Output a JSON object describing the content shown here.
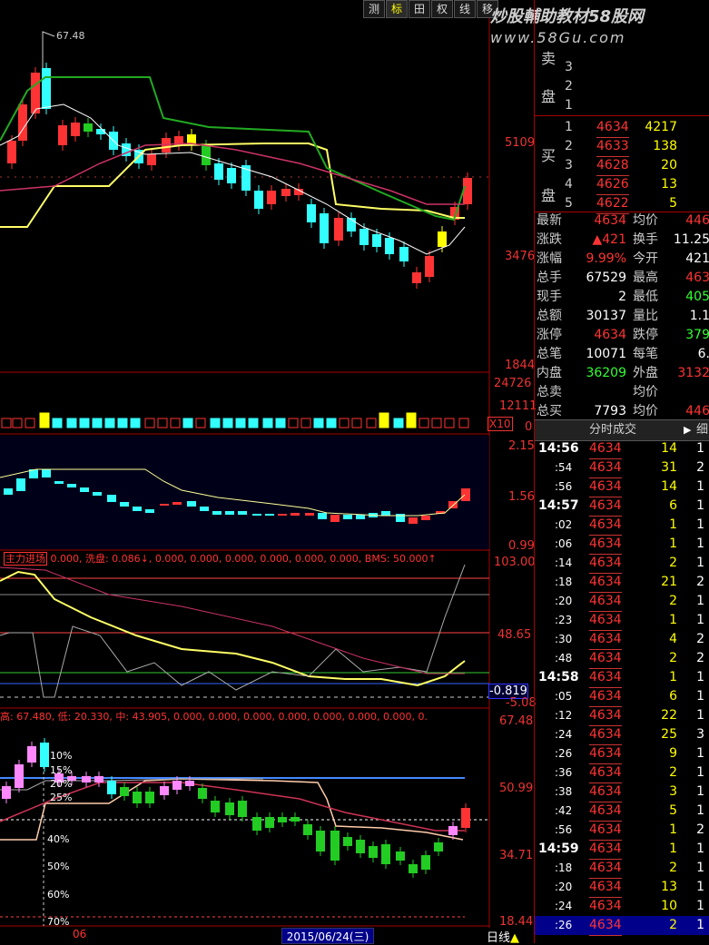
{
  "toolbar": [
    "测",
    "标",
    "田",
    "权",
    "线",
    "移"
  ],
  "toolbar_active": 1,
  "watermark": {
    "line1": "炒股輔助教材58股网",
    "line2": "www.58Gu.com"
  },
  "price_axis": [
    "5109",
    "3476",
    "1844"
  ],
  "peak_label": "67.48",
  "vol_axis": [
    "24726",
    "12111",
    "0"
  ],
  "vol_unit": "X10",
  "mid_axis": [
    "2.15",
    "1.56",
    "0.99"
  ],
  "ind1": {
    "title": "主力进场",
    "values": "0.000, 洗盘: 0.086↓, 0.000, 0.000, 0.000, 0.000, 0.000, 0.000, BMS: 50.000↑",
    "axis": [
      "103.00",
      "48.65",
      "-0.819",
      "-5.08"
    ]
  },
  "ind2": {
    "label": "高: 67.480, 低: 20.330, 中: 43.905, 0.000, 0.000, 0.000, 0.000, 0.000, 0.000, 0.000, 0.",
    "axis": [
      "67.48",
      "50.99",
      "34.71",
      "18.44"
    ],
    "pcts": [
      "10%",
      "15%",
      "20%",
      "25%",
      "40%",
      "50%",
      "60%",
      "70%"
    ]
  },
  "bottom": {
    "date": "2015/06/24(三)",
    "cycle": "日线",
    "left": "06"
  },
  "sell_side": {
    "label": "卖盘",
    "rows": [
      {
        "n": "3"
      },
      {
        "n": "2"
      },
      {
        "n": "1"
      }
    ]
  },
  "buy_side": {
    "label": "买盘",
    "rows": [
      {
        "n": "1",
        "price": "4634",
        "vol": "4217"
      },
      {
        "n": "2",
        "price": "4633",
        "vol": "138"
      },
      {
        "n": "3",
        "price": "4628",
        "vol": "20"
      },
      {
        "n": "4",
        "price": "4626",
        "vol": "13"
      },
      {
        "n": "5",
        "price": "4622",
        "vol": "5"
      }
    ]
  },
  "quote": [
    {
      "l1": "最新",
      "v1": "4634",
      "l2": "均价",
      "v2": "446",
      "c1": "red",
      "c2": "red"
    },
    {
      "l1": "涨跌",
      "v1": "▲421",
      "l2": "换手",
      "v2": "11.25",
      "c1": "red",
      "c2": "white"
    },
    {
      "l1": "涨幅",
      "v1": "9.99%",
      "l2": "今开",
      "v2": "421",
      "c1": "red",
      "c2": "white"
    },
    {
      "l1": "总手",
      "v1": "67529",
      "l2": "最高",
      "v2": "463",
      "c1": "white",
      "c2": "red"
    },
    {
      "l1": "现手",
      "v1": "2",
      "l2": "最低",
      "v2": "405",
      "c1": "white",
      "c2": "green"
    },
    {
      "l1": "总额",
      "v1": "30137",
      "l2": "量比",
      "v2": "1.1",
      "c1": "white",
      "c2": "white"
    },
    {
      "l1": "涨停",
      "v1": "4634",
      "l2": "跌停",
      "v2": "379",
      "c1": "red",
      "c2": "green"
    },
    {
      "l1": "总笔",
      "v1": "10071",
      "l2": "每笔",
      "v2": "6.",
      "c1": "white",
      "c2": "white"
    },
    {
      "l1": "内盘",
      "v1": "36209",
      "l2": "外盘",
      "v2": "3132",
      "c1": "green",
      "c2": "red"
    },
    {
      "l1": "总卖",
      "v1": "",
      "l2": "均价",
      "v2": "",
      "c1": "white",
      "c2": "white"
    },
    {
      "l1": "总买",
      "v1": "7793",
      "l2": "均价",
      "v2": "446",
      "c1": "white",
      "c2": "red"
    }
  ],
  "trade_header": {
    "title": "分时成交",
    "more": "细"
  },
  "trades": [
    {
      "t": "14:56",
      "p": "4634",
      "v": "14",
      "f": "1"
    },
    {
      "t": ":54",
      "p": "4634",
      "v": "31",
      "f": "2"
    },
    {
      "t": ":56",
      "p": "4634",
      "v": "14",
      "f": "1"
    },
    {
      "t": "14:57",
      "p": "4634",
      "v": "6",
      "f": "1"
    },
    {
      "t": ":02",
      "p": "4634",
      "v": "1",
      "f": "1"
    },
    {
      "t": ":06",
      "p": "4634",
      "v": "1",
      "f": "1"
    },
    {
      "t": ":14",
      "p": "4634",
      "v": "2",
      "f": "1"
    },
    {
      "t": ":18",
      "p": "4634",
      "v": "21",
      "f": "2"
    },
    {
      "t": ":20",
      "p": "4634",
      "v": "2",
      "f": "1"
    },
    {
      "t": ":23",
      "p": "4634",
      "v": "1",
      "f": "1"
    },
    {
      "t": ":30",
      "p": "4634",
      "v": "4",
      "f": "2"
    },
    {
      "t": ":48",
      "p": "4634",
      "v": "2",
      "f": "2"
    },
    {
      "t": "14:58",
      "p": "4634",
      "v": "1",
      "f": "1"
    },
    {
      "t": ":05",
      "p": "4634",
      "v": "6",
      "f": "1"
    },
    {
      "t": ":12",
      "p": "4634",
      "v": "22",
      "f": "1"
    },
    {
      "t": ":24",
      "p": "4634",
      "v": "25",
      "f": "3"
    },
    {
      "t": ":26",
      "p": "4634",
      "v": "9",
      "f": "1"
    },
    {
      "t": ":36",
      "p": "4634",
      "v": "2",
      "f": "1"
    },
    {
      "t": ":38",
      "p": "4634",
      "v": "3",
      "f": "1"
    },
    {
      "t": ":42",
      "p": "4634",
      "v": "5",
      "f": "1"
    },
    {
      "t": ":56",
      "p": "4634",
      "v": "1",
      "f": "2"
    },
    {
      "t": "14:59",
      "p": "4634",
      "v": "1",
      "f": "1"
    },
    {
      "t": ":18",
      "p": "4634",
      "v": "2",
      "f": "1"
    },
    {
      "t": ":20",
      "p": "4634",
      "v": "13",
      "f": "1"
    },
    {
      "t": ":24",
      "p": "4634",
      "v": "10",
      "f": "1"
    },
    {
      "t": ":26",
      "p": "4634",
      "v": "2",
      "f": "1"
    }
  ],
  "colors": {
    "up": "#ff3333",
    "down": "#33ffff",
    "ma_yellow": "#ffff66",
    "ma_green": "#22aa22",
    "ma_white": "#ffffff",
    "ma_pink": "#cc3366"
  }
}
